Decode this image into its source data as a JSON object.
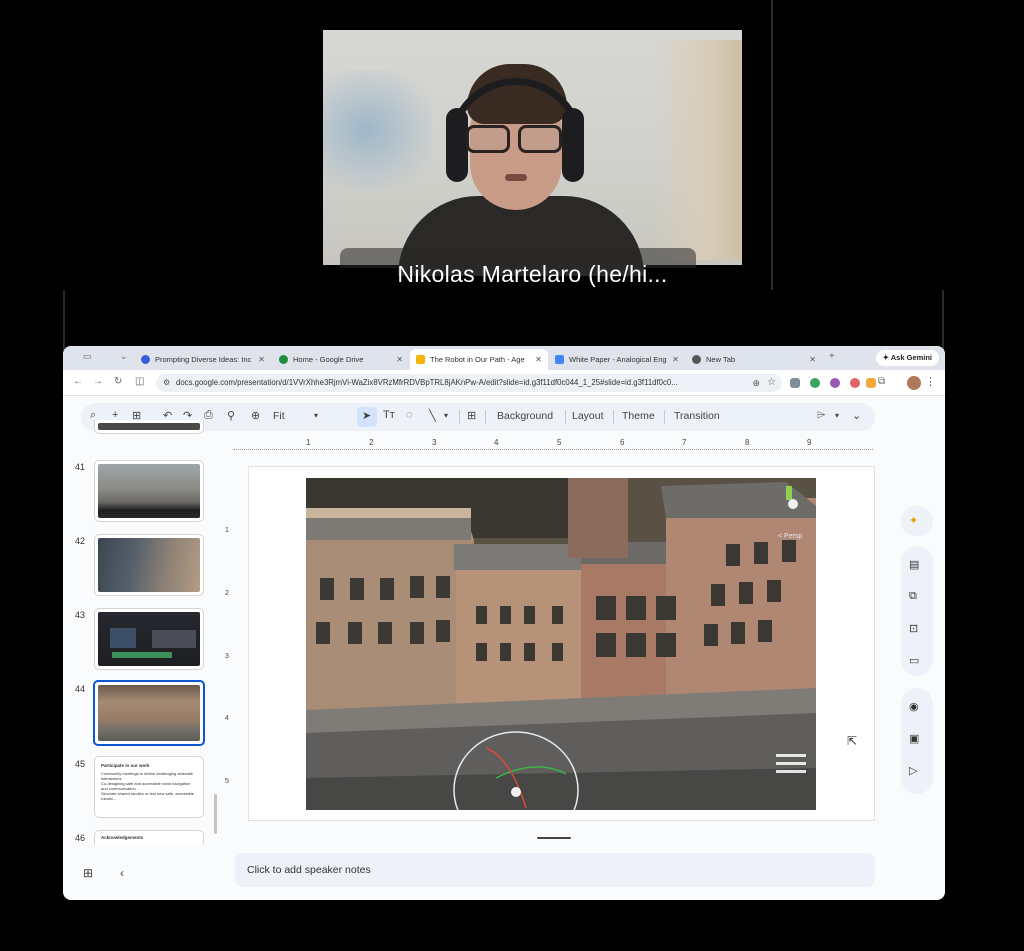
{
  "call": {
    "participant_name": "Nikolas Martelaro (he/hi..."
  },
  "browser": {
    "tabs": [
      {
        "label": "Prompting Diverse Ideas: Inc",
        "color": "#3b5bdb"
      },
      {
        "label": "Home - Google Drive",
        "color": "#1e8e3e"
      },
      {
        "label": "The Robot in Our Path - Age",
        "color": "#f4b400"
      },
      {
        "label": "White Paper - Analogical Eng",
        "color": "#4285f4"
      },
      {
        "label": "New Tab",
        "color": "#555555"
      }
    ],
    "new_tab": "+",
    "ask_gemini": "Ask Gemini",
    "url": "docs.google.com/presentation/d/1VVrXhhe3RjmVi-WaZix8VRzMfrRDVBpTRL8jAKnPw-A/edit?slide=id.g3f11df0c044_1_25#slide=id.g3f11df0c0..."
  },
  "toolbar": {
    "zoom": "Fit",
    "background": "Background",
    "layout": "Layout",
    "theme": "Theme",
    "transition": "Transition"
  },
  "filmstrip": {
    "slides": [
      {
        "num": "41"
      },
      {
        "num": "42"
      },
      {
        "num": "43"
      },
      {
        "num": "44"
      },
      {
        "num": "45",
        "title": "Participate in our work",
        "bullets": [
          "Community meetings to define challenging sidewalk interactions",
          "Co-designing safe and accessible robot navigation and communication",
          "Simulate shared studies or test new safe, accessible robotic..."
        ]
      },
      {
        "num": "46",
        "title": "Acknowledgements"
      }
    ]
  },
  "ruler": {
    "h": [
      "1",
      "2",
      "3",
      "4",
      "5",
      "6",
      "7",
      "8",
      "9"
    ],
    "v": [
      "1",
      "2",
      "3",
      "4",
      "5"
    ]
  },
  "slide": {
    "scene_label": "< Persp"
  },
  "notes": {
    "placeholder": "Click to add speaker notes"
  },
  "colors": {
    "accent": "#0b57d0",
    "tab_bar": "#dfe3eb",
    "toolbar": "#edf1f8"
  }
}
